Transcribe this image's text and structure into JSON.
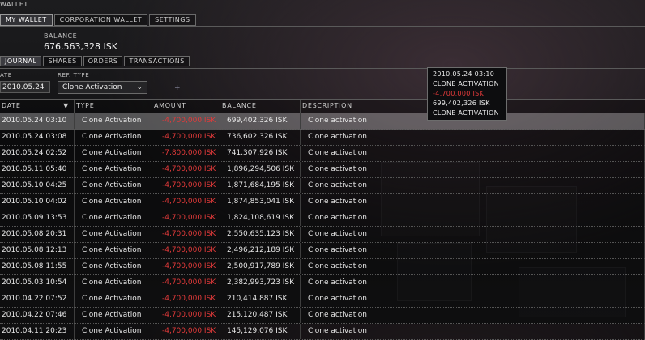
{
  "window_title": "WALLET",
  "tabs": [
    "MY WALLET",
    "CORPORATION WALLET",
    "SETTINGS"
  ],
  "balance": {
    "label": "BALANCE",
    "value": "676,563,328 ISK"
  },
  "subtabs": [
    "JOURNAL",
    "SHARES",
    "ORDERS",
    "TRANSACTIONS"
  ],
  "filters": {
    "date_label": "ATE",
    "date_value": "2010.05.24",
    "reftype_label": "REF. TYPE",
    "reftype_value": "Clone Activation"
  },
  "columns": [
    "DATE",
    "TYPE",
    "AMOUNT",
    "BALANCE",
    "DESCRIPTION"
  ],
  "rows": [
    {
      "date": "2010.05.24  03:10",
      "type": "Clone Activation",
      "amount": "-4,700,000 ISK",
      "balance": "699,402,326 ISK",
      "desc": "Clone activation"
    },
    {
      "date": "2010.05.24  03:08",
      "type": "Clone Activation",
      "amount": "-4,700,000 ISK",
      "balance": "736,602,326 ISK",
      "desc": "Clone activation"
    },
    {
      "date": "2010.05.24  02:52",
      "type": "Clone Activation",
      "amount": "-7,800,000 ISK",
      "balance": "741,307,926 ISK",
      "desc": "Clone activation"
    },
    {
      "date": "2010.05.11  05:40",
      "type": "Clone Activation",
      "amount": "-4,700,000 ISK",
      "balance": "1,896,294,506 ISK",
      "desc": "Clone activation"
    },
    {
      "date": "2010.05.10  04:25",
      "type": "Clone Activation",
      "amount": "-4,700,000 ISK",
      "balance": "1,871,684,195 ISK",
      "desc": "Clone activation"
    },
    {
      "date": "2010.05.10  04:02",
      "type": "Clone Activation",
      "amount": "-4,700,000 ISK",
      "balance": "1,874,853,041 ISK",
      "desc": "Clone activation"
    },
    {
      "date": "2010.05.09  13:53",
      "type": "Clone Activation",
      "amount": "-4,700,000 ISK",
      "balance": "1,824,108,619 ISK",
      "desc": "Clone activation"
    },
    {
      "date": "2010.05.08  20:31",
      "type": "Clone Activation",
      "amount": "-4,700,000 ISK",
      "balance": "2,550,635,123 ISK",
      "desc": "Clone activation"
    },
    {
      "date": "2010.05.08  12:13",
      "type": "Clone Activation",
      "amount": "-4,700,000 ISK",
      "balance": "2,496,212,189 ISK",
      "desc": "Clone activation"
    },
    {
      "date": "2010.05.08  11:55",
      "type": "Clone Activation",
      "amount": "-4,700,000 ISK",
      "balance": "2,500,917,789 ISK",
      "desc": "Clone activation"
    },
    {
      "date": "2010.05.03  10:54",
      "type": "Clone Activation",
      "amount": "-4,700,000 ISK",
      "balance": "2,382,993,723 ISK",
      "desc": "Clone activation"
    },
    {
      "date": "2010.04.22  07:52",
      "type": "Clone Activation",
      "amount": "-4,700,000 ISK",
      "balance": "210,414,887 ISK",
      "desc": "Clone activation"
    },
    {
      "date": "2010.04.22  07:46",
      "type": "Clone Activation",
      "amount": "-4,700,000 ISK",
      "balance": "215,120,487 ISK",
      "desc": "Clone activation"
    },
    {
      "date": "2010.04.11  20:23",
      "type": "Clone Activation",
      "amount": "-4,700,000 ISK",
      "balance": "145,129,076 ISK",
      "desc": "Clone activation"
    }
  ],
  "tooltip": [
    "2010.05.24 03:10",
    "CLONE ACTIVATION",
    "-4,700,000 ISK",
    "699,402,326 ISK",
    "CLONE ACTIVATION"
  ],
  "colors": {
    "negative": "#e23a3a",
    "selected_row": "#8c8c8c"
  }
}
